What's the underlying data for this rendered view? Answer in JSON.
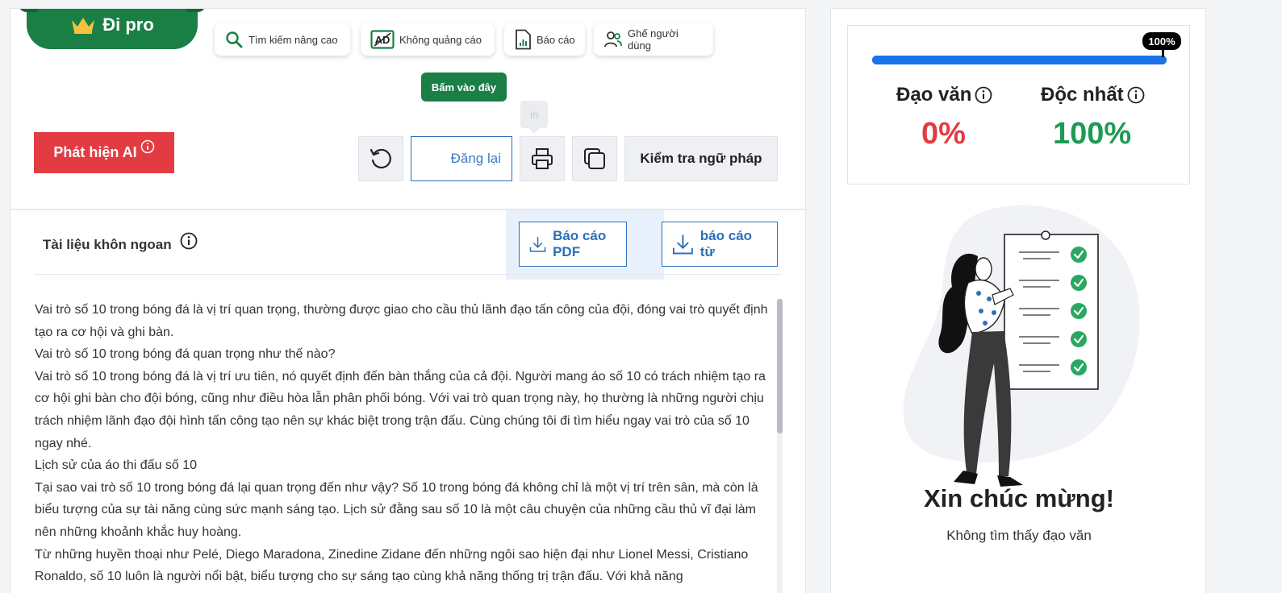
{
  "pro": {
    "label": "Đi pro"
  },
  "features": [
    {
      "label": "Tìm kiếm nâng cao"
    },
    {
      "label": "Không quảng cáo"
    },
    {
      "label": "Báo cáo"
    },
    {
      "label": "Ghế người dùng"
    }
  ],
  "click_here": "Bấm vào đây",
  "print_tooltip": "In",
  "ai_detect": "Phát hiện AI",
  "toolbar": {
    "repost": "Đăng lại",
    "grammar": "Kiểm tra ngữ pháp"
  },
  "document": {
    "title": "Tài liệu khôn ngoan",
    "pdf_report": "Báo cáo PDF",
    "word_report": "báo cáo từ",
    "paragraphs": [
      "Vai trò số 10 trong bóng đá là vị trí quan trọng, thường được giao cho cầu thủ lãnh đạo tấn công của đội, đóng vai trò quyết định tạo ra cơ hội và ghi bàn.",
      "Vai trò số 10 trong bóng đá quan trọng như thế nào?",
      "Vai trò số 10 trong bóng đá là vị trí ưu tiên, nó quyết định đến bàn thắng của cả đội. Người mang áo số 10 có trách nhiệm tạo ra cơ hội ghi bàn cho đội bóng, cũng như điều hòa lẫn phân phối bóng. Với vai trò quan trọng này, họ thường là những người chịu trách nhiệm lãnh đạo đội hình tấn công tạo nên sự khác biệt trong trận đấu. Cùng chúng tôi đi tìm hiểu ngay vai trò của số 10 ngay nhé.",
      "Lịch sử của áo thi đấu số 10",
      "Tại sao vai trò số 10 trong bóng đá lại quan trọng đến như vậy? Số 10 trong bóng đá không chỉ là một vị trí trên sân, mà còn là biểu tượng của sự tài năng cùng sức mạnh sáng tạo. Lịch sử đằng sau số 10 là một câu chuyện của những cầu thủ vĩ đại làm nên những khoảnh khắc huy hoàng.",
      "Từ những huyền thoại như Pelé, Diego Maradona, Zinedine Zidane đến những ngôi sao hiện đại như Lionel Messi, Cristiano Ronaldo, số 10 luôn là người nổi bật, biểu tượng cho sự sáng tạo cùng khả năng thống trị trận đấu. Với khả năng"
    ]
  },
  "score": {
    "progress": 100,
    "progress_label": "100%",
    "plagiarism_label": "Đạo văn",
    "plagiarism_value": "0%",
    "unique_label": "Độc nhất",
    "unique_value": "100%"
  },
  "result": {
    "title": "Xin chúc mừng!",
    "subtitle": "Không tìm thấy đạo văn"
  },
  "colors": {
    "brand_green": "#1a7f45",
    "danger_red": "#e23c42",
    "link_blue": "#2d6fb8",
    "progress_blue": "#1a73e8",
    "unique_green": "#1f9a55"
  }
}
